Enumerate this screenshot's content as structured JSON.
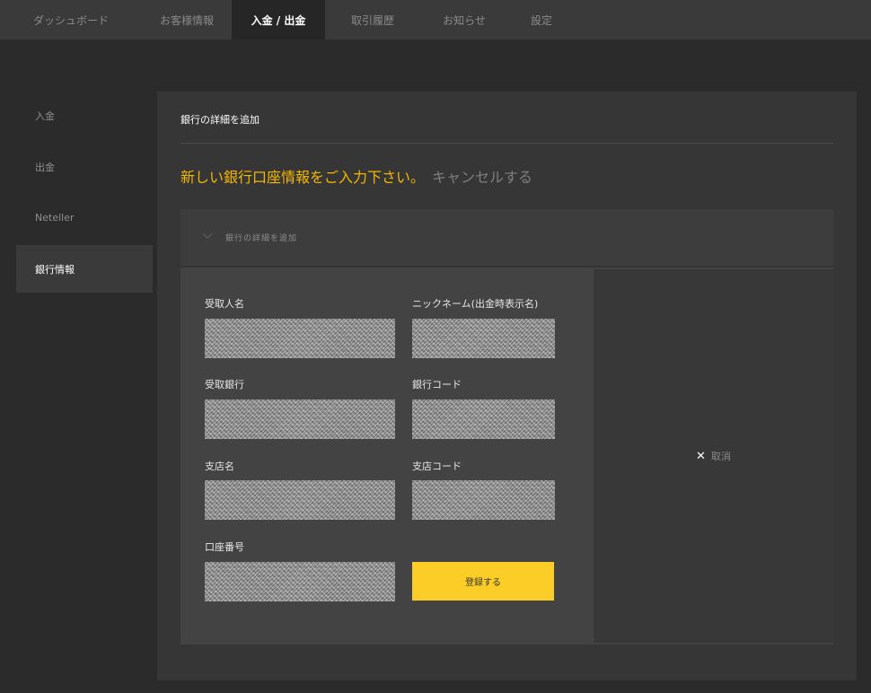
{
  "topnav": {
    "tabs": [
      {
        "label": "ダッシュボード"
      },
      {
        "label": "お客様情報"
      },
      {
        "label": "入金 / 出金"
      },
      {
        "label": "取引履歴"
      },
      {
        "label": "お知らせ"
      },
      {
        "label": "設定"
      }
    ],
    "active_index": 2
  },
  "sidebar": {
    "items": [
      {
        "label": "入金"
      },
      {
        "label": "出金"
      },
      {
        "label": "Neteller"
      },
      {
        "label": "銀行情報"
      }
    ],
    "active_index": 3
  },
  "panel": {
    "title": "銀行の詳細を追加",
    "prompt": "新しい銀行口座情報をご入力下さい。",
    "cancel_link": "キャンセルする",
    "accordion_title": "銀行の詳細を追加"
  },
  "form": {
    "recipient_name": {
      "label": "受取人名",
      "value": ""
    },
    "nickname": {
      "label": "ニックネーム(出金時表示名)",
      "value": ""
    },
    "recipient_bank": {
      "label": "受取銀行",
      "value": ""
    },
    "bank_code": {
      "label": "銀行コード",
      "value": ""
    },
    "branch_name": {
      "label": "支店名",
      "value": ""
    },
    "branch_code": {
      "label": "支店コード",
      "value": ""
    },
    "account_number": {
      "label": "口座番号",
      "value": ""
    },
    "submit_label": "登録する",
    "cancel_label": "取消"
  },
  "colors": {
    "accent": "#fccd26",
    "prompt": "#f5b700"
  }
}
